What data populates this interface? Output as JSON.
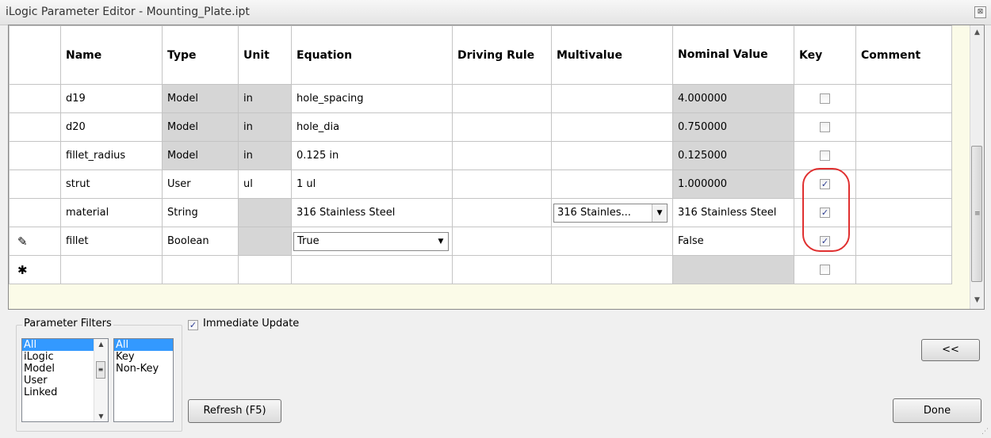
{
  "window": {
    "title": "iLogic Parameter Editor - Mounting_Plate.ipt",
    "close_glyph": "⊠"
  },
  "grid": {
    "columns": [
      "Name",
      "Type",
      "Unit",
      "Equation",
      "Driving Rule",
      "Multivalue",
      "Nominal Value",
      "Key",
      "Comment"
    ],
    "rows": [
      {
        "indicator": "",
        "name": "d19",
        "type": "Model",
        "unit": "in",
        "equation": "hole_spacing",
        "driving_rule": "",
        "multivalue": "",
        "nominal_value": "4.000000",
        "key": false,
        "comment": ""
      },
      {
        "indicator": "",
        "name": "d20",
        "type": "Model",
        "unit": "in",
        "equation": "hole_dia",
        "driving_rule": "",
        "multivalue": "",
        "nominal_value": "0.750000",
        "key": false,
        "comment": ""
      },
      {
        "indicator": "",
        "name": "fillet_radius",
        "type": "Model",
        "unit": "in",
        "equation": "0.125 in",
        "driving_rule": "",
        "multivalue": "",
        "nominal_value": "0.125000",
        "key": false,
        "comment": ""
      },
      {
        "indicator": "",
        "name": "strut",
        "type": "User",
        "unit": "ul",
        "equation": "1 ul",
        "driving_rule": "",
        "multivalue": "",
        "nominal_value": "1.000000",
        "key": true,
        "comment": ""
      },
      {
        "indicator": "",
        "name": "material",
        "type": "String",
        "unit": "",
        "equation": "316 Stainless Steel",
        "driving_rule": "",
        "multivalue": "316 Stainles...",
        "nominal_value": "316 Stainless Steel",
        "key": true,
        "comment": ""
      },
      {
        "indicator": "✎",
        "name": "fillet",
        "type": "Boolean",
        "unit": "",
        "equation": "True",
        "driving_rule": "",
        "multivalue": "",
        "nominal_value": "False",
        "key": true,
        "comment": ""
      },
      {
        "indicator": "✱",
        "name": "",
        "type": "",
        "unit": "",
        "equation": "",
        "driving_rule": "",
        "multivalue": "",
        "nominal_value": "",
        "key": false,
        "comment": ""
      }
    ]
  },
  "filters": {
    "label": "Parameter Filters",
    "list1": [
      "All",
      "iLogic",
      "Model",
      "User",
      "Linked"
    ],
    "list1_selected": "All",
    "list2": [
      "All",
      "Key",
      "Non-Key"
    ],
    "list2_selected": "All"
  },
  "immediate_update": {
    "label": "Immediate Update",
    "checked": true
  },
  "buttons": {
    "refresh": "Refresh (F5)",
    "collapse": "<<",
    "done": "Done"
  },
  "colors": {
    "highlight": "#e03030",
    "selection": "#3399ff",
    "computed_cell": "#d6d6d6",
    "grid_background": "#fbfbe8"
  }
}
